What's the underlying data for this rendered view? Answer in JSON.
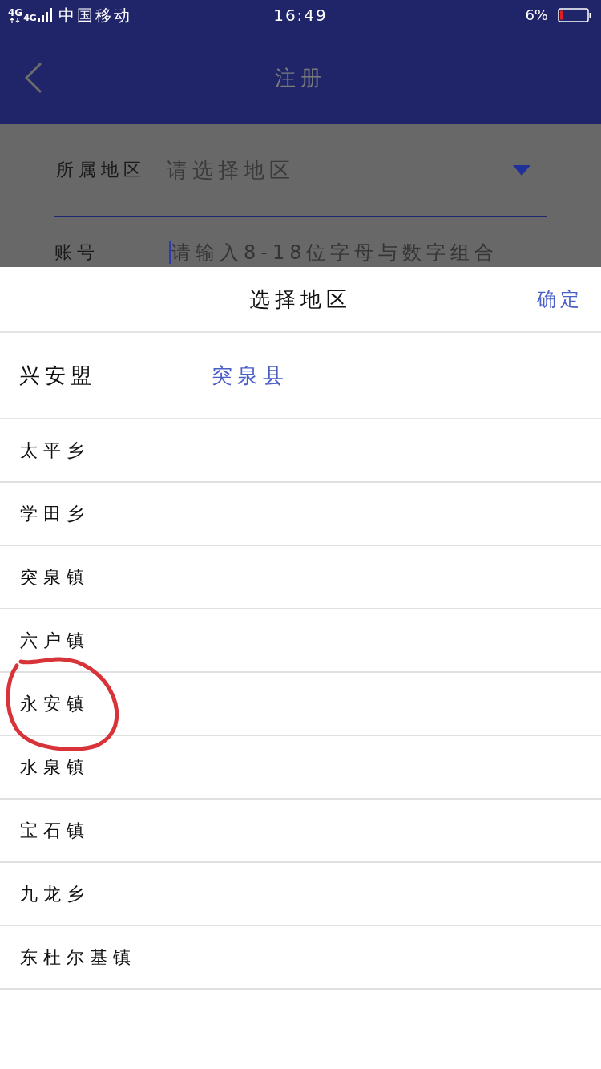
{
  "status_bar": {
    "network": [
      "4G",
      "4G"
    ],
    "carrier": "中国移动",
    "time": "16:49",
    "battery": "6%"
  },
  "header": {
    "title": "注册"
  },
  "form": {
    "region": {
      "label": "所属地区",
      "placeholder": "请选择地区"
    },
    "account": {
      "label": "账号",
      "placeholder": "请输入8-18位字母与数字组合"
    }
  },
  "picker": {
    "title": "选择地区",
    "confirm": "确定",
    "tabs": [
      {
        "label": "兴安盟",
        "selected": false
      },
      {
        "label": "突泉县",
        "selected": true
      }
    ],
    "items": [
      {
        "label": "太平乡",
        "selected": false,
        "circled": false
      },
      {
        "label": "学田乡",
        "selected": false,
        "circled": false
      },
      {
        "label": "突泉镇",
        "selected": false,
        "circled": false
      },
      {
        "label": "六户镇",
        "selected": false,
        "circled": false
      },
      {
        "label": "永安镇",
        "selected": false,
        "circled": true
      },
      {
        "label": "水泉镇",
        "selected": false,
        "circled": false
      },
      {
        "label": "宝石镇",
        "selected": false,
        "circled": false
      },
      {
        "label": "九龙乡",
        "selected": false,
        "circled": false
      },
      {
        "label": "东杜尔基镇",
        "selected": false,
        "circled": false
      }
    ]
  }
}
